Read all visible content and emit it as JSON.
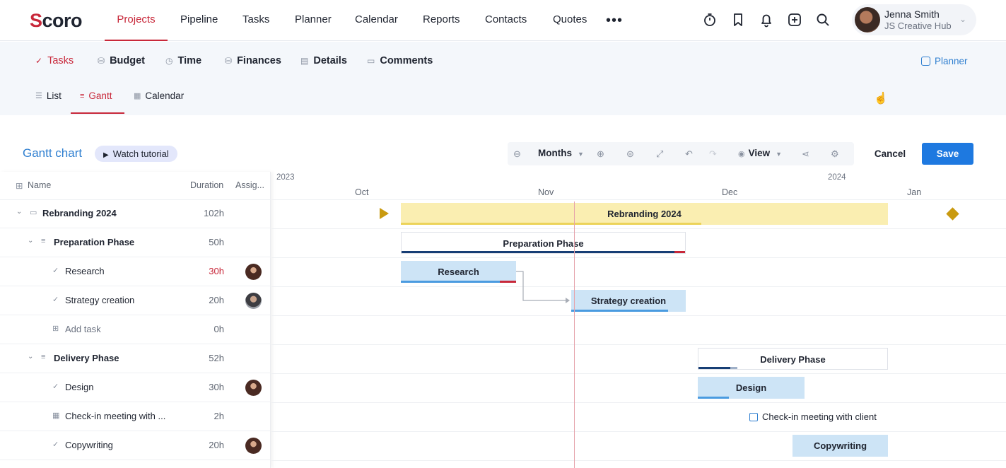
{
  "brand": {
    "logo_s": "S",
    "logo_rest": "coro"
  },
  "nav": {
    "items": [
      {
        "label": "Projects",
        "active": true
      },
      {
        "label": "Pipeline"
      },
      {
        "label": "Tasks"
      },
      {
        "label": "Planner"
      },
      {
        "label": "Calendar"
      },
      {
        "label": "Reports"
      },
      {
        "label": "Contacts"
      },
      {
        "label": "Quotes"
      }
    ],
    "more": "•••",
    "icons": [
      "timer-icon",
      "bookmark-icon",
      "bell-icon",
      "add-icon",
      "search-icon"
    ]
  },
  "user": {
    "name": "Jenna Smith",
    "org": "JS Creative Hub"
  },
  "project_tabs": {
    "items": [
      {
        "label": "Tasks",
        "icon": "check-icon",
        "active": true
      },
      {
        "label": "Budget",
        "icon": "budget-icon"
      },
      {
        "label": "Time",
        "icon": "clock-icon"
      },
      {
        "label": "Finances",
        "icon": "finances-icon"
      },
      {
        "label": "Details",
        "icon": "document-icon"
      },
      {
        "label": "Comments",
        "icon": "comment-icon"
      }
    ],
    "planner_link": "Planner"
  },
  "view_tabs": {
    "items": [
      {
        "label": "List",
        "icon": "list-icon"
      },
      {
        "label": "Gantt",
        "icon": "gantt-icon",
        "active": true
      },
      {
        "label": "Calendar",
        "icon": "calendar-icon"
      }
    ]
  },
  "gantt": {
    "title": "Gantt chart",
    "tutorial": "Watch tutorial",
    "tutorial_icon": "▶",
    "scale": "Months",
    "view": "View",
    "cancel": "Cancel",
    "save": "Save"
  },
  "columns": {
    "name": "Name",
    "duration": "Duration",
    "assignee": "Assig..."
  },
  "rows": [
    {
      "name": "Rebranding 2024",
      "duration": "102h",
      "type": "project"
    },
    {
      "name": "Preparation Phase",
      "duration": "50h",
      "type": "phase"
    },
    {
      "name": "Research",
      "duration": "30h",
      "type": "task",
      "over": true,
      "assignee": "female"
    },
    {
      "name": "Strategy creation",
      "duration": "20h",
      "type": "task",
      "assignee": "male"
    },
    {
      "name": "Add task",
      "duration": "0h",
      "type": "add"
    },
    {
      "name": "Delivery Phase",
      "duration": "52h",
      "type": "phase"
    },
    {
      "name": "Design",
      "duration": "30h",
      "type": "task",
      "assignee": "female"
    },
    {
      "name": "Check-in meeting with ...",
      "duration": "2h",
      "type": "meeting"
    },
    {
      "name": "Copywriting",
      "duration": "20h",
      "type": "task",
      "assignee": "female"
    }
  ],
  "timeline": {
    "years": [
      "2023",
      "2024"
    ],
    "months": [
      "Oct",
      "Nov",
      "Dec",
      "Jan"
    ]
  },
  "bars": {
    "project": "Rebranding 2024",
    "phase1": "Preparation Phase",
    "research": "Research",
    "strategy": "Strategy creation",
    "phase2": "Delivery Phase",
    "design": "Design",
    "meeting": "Check-in meeting with client",
    "copywriting": "Copywriting"
  },
  "colors": {
    "accent": "#c8283a",
    "primary": "#1e79e0",
    "link": "#2f7fd0",
    "summary": "#faeeb1",
    "task": "#cde4f6",
    "milestone": "#c99a10"
  }
}
